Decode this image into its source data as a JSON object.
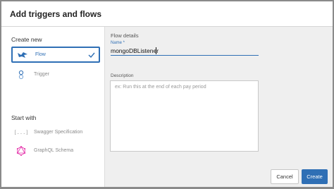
{
  "dialog": {
    "title": "Add triggers and flows"
  },
  "sidebar": {
    "create_new_label": "Create new",
    "start_with_label": "Start with",
    "create_items": [
      {
        "label": "Flow",
        "icon": "flow-bird-icon",
        "selected": true
      },
      {
        "label": "Trigger",
        "icon": "trigger-icon",
        "selected": false
      }
    ],
    "start_items": [
      {
        "label": "Swagger Specification",
        "icon": "swagger-brackets-icon"
      },
      {
        "label": "GraphQL Schema",
        "icon": "graphql-icon"
      }
    ]
  },
  "form": {
    "section_title": "Flow details",
    "name_label": "Name *",
    "name_value": "mongoDBListener",
    "description_label": "Description",
    "description_placeholder": "ex: Run this at the end of each pay period"
  },
  "footer": {
    "cancel_label": "Cancel",
    "create_label": "Create"
  },
  "colors": {
    "accent": "#2f6fb5",
    "graphql": "#e535ab"
  }
}
